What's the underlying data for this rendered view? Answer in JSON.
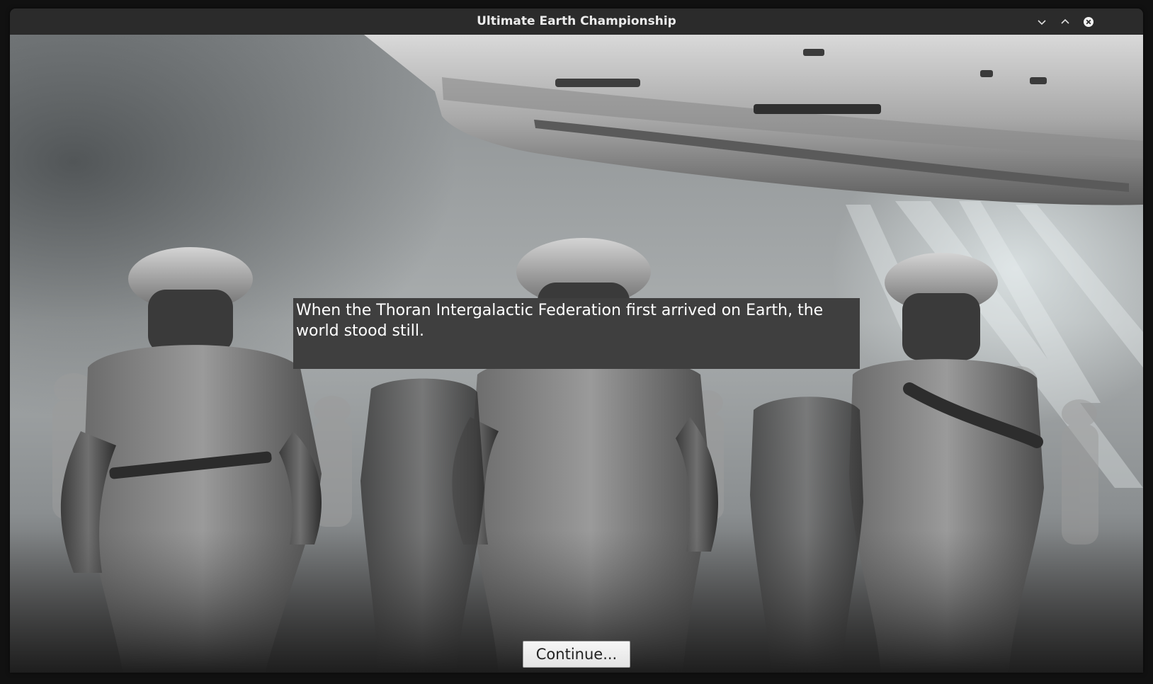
{
  "window": {
    "title": "Ultimate Earth Championship",
    "controls": {
      "minimize_icon": "chevron-down-icon",
      "maximize_icon": "chevron-up-icon",
      "close_icon": "close-icon"
    }
  },
  "scene": {
    "background": "monochrome illustration: flying saucer over marching alien soldiers",
    "narration_text": "When the Thoran Intergalactic Federation first arrived on Earth, the world stood still.",
    "continue_label": "Continue..."
  },
  "colors": {
    "titlebar": "#2b2b2b",
    "title_text": "#ececec",
    "narration_bg": "#3f3f3f",
    "narration_text": "#ffffff",
    "button_bg": "#eeeeee"
  }
}
